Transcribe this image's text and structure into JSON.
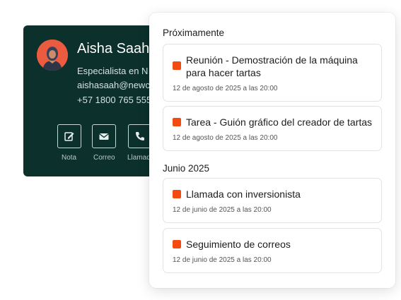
{
  "contact": {
    "name": "Aisha Saah",
    "role": "Especialista en N",
    "email": "aishasaah@newc",
    "phone": "+57 1800 765 555",
    "actions": [
      {
        "label": "Nota",
        "icon": "edit-icon"
      },
      {
        "label": "Correo",
        "icon": "mail-icon"
      },
      {
        "label": "Llamad",
        "icon": "phone-icon"
      }
    ]
  },
  "activities": {
    "sections": [
      {
        "title": "Próximamente",
        "items": [
          {
            "title": "Reunión - Demostración de la máquina para hacer tartas",
            "date": "12 de agosto de 2025 a las 20:00"
          },
          {
            "title": "Tarea - Guión gráfico del creador de tartas",
            "date": "12 de agosto de 2025 a las 20:00"
          }
        ]
      },
      {
        "title": "Junio 2025",
        "items": [
          {
            "title": "Llamada con inversionista",
            "date": "12 de junio de 2025 a las 20:00"
          },
          {
            "title": "Seguimiento de correos",
            "date": "12 de junio de 2025 a las 20:00"
          }
        ]
      }
    ]
  },
  "colors": {
    "accent": "#f24a11",
    "card_bg": "#0c302c",
    "avatar_bg": "#ea5b3f"
  }
}
